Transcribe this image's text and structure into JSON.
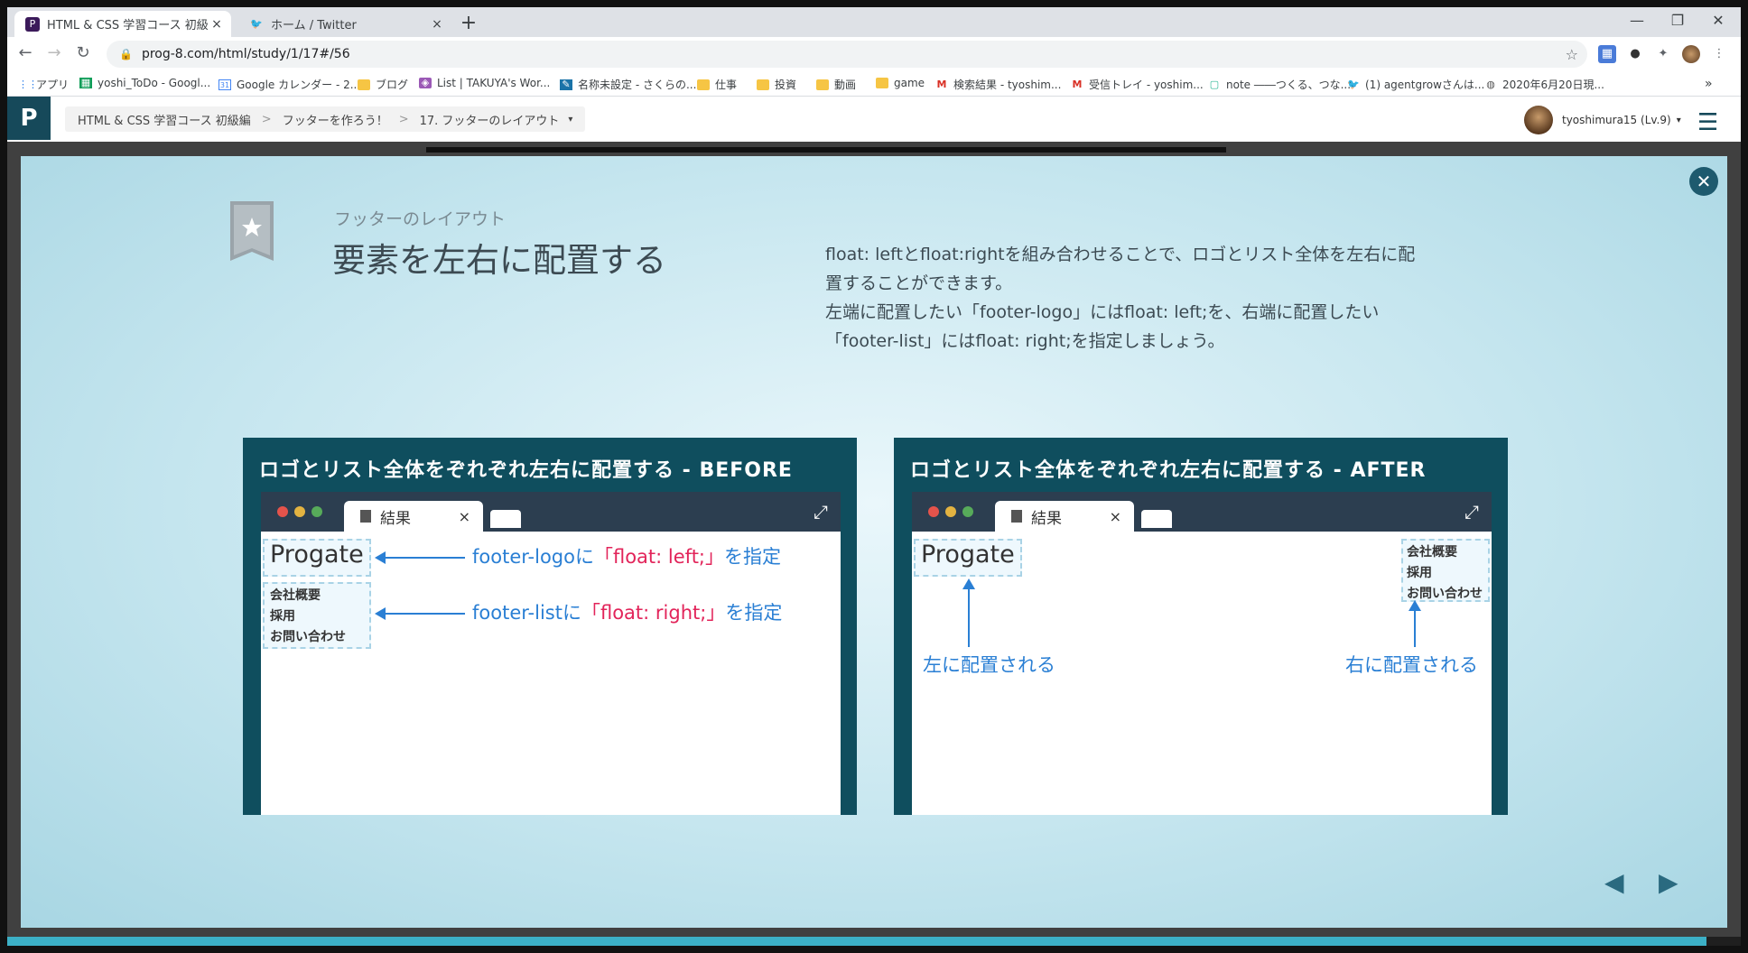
{
  "browser": {
    "tabs": [
      {
        "title": "HTML & CSS 学習コース 初級編 | ",
        "close": "×",
        "icon": "progate-icon",
        "icon_glyph": "P"
      },
      {
        "title": "ホーム / Twitter",
        "close": "×",
        "icon": "twitter-icon",
        "icon_glyph": "🐦"
      }
    ],
    "new_tab": "+",
    "window_controls": {
      "minimize": "—",
      "restore": "❐",
      "close": "✕"
    },
    "nav": {
      "back": "←",
      "forward": "→",
      "reload": "↻"
    },
    "url": "prog-8.com/html/study/1/17#/56",
    "lock": "🔒",
    "star": "☆",
    "bookmarks": [
      {
        "label": "アプリ",
        "icon": "apps-icon",
        "glyph": "⋮⋮"
      },
      {
        "label": "yoshi_ToDo - Googl...",
        "icon": "sheets-icon",
        "glyph": "▦"
      },
      {
        "label": "Google カレンダー - 2...",
        "icon": "calendar-icon",
        "glyph": "31"
      },
      {
        "label": "ブログ",
        "icon": "folder-icon",
        "glyph": ""
      },
      {
        "label": "List | TAKUYA's Wor...",
        "icon": "list-icon",
        "glyph": "◈"
      },
      {
        "label": "名称未設定 - さくらの...",
        "icon": "sakura-icon",
        "glyph": "✎"
      },
      {
        "label": "仕事",
        "icon": "folder-icon",
        "glyph": ""
      },
      {
        "label": "投資",
        "icon": "folder-icon",
        "glyph": ""
      },
      {
        "label": "動画",
        "icon": "folder-icon",
        "glyph": ""
      },
      {
        "label": "game",
        "icon": "folder-icon",
        "glyph": ""
      },
      {
        "label": "検索結果 - tyoshim...",
        "icon": "gmail-icon",
        "glyph": "M"
      },
      {
        "label": "受信トレイ - yoshim...",
        "icon": "gmail-icon",
        "glyph": "M"
      },
      {
        "label": "note ――つくる、つな...",
        "icon": "note-icon",
        "glyph": "▢"
      },
      {
        "label": "(1) agentgrowさんは...",
        "icon": "twitter-icon",
        "glyph": "🐦"
      },
      {
        "label": "2020年6月20日現...",
        "icon": "globe-icon",
        "glyph": "◍"
      }
    ],
    "bookmarks_more": "»"
  },
  "app": {
    "logo": "P",
    "breadcrumb": [
      "HTML & CSS 学習コース 初級編",
      "フッターを作ろう！",
      "17. フッターのレイアウト"
    ],
    "breadcrumb_sep": ">",
    "breadcrumb_caret": "▾",
    "user": "tyoshimura15 (Lv.9)",
    "user_caret": "▾",
    "menu": "☰"
  },
  "slide": {
    "close": "✕",
    "subtitle": "フッターのレイアウト",
    "title": "要素を左右に配置する",
    "description": [
      "float: leftとfloat:rightを組み合わせることで、ロゴとリスト全体を左右に配",
      "置することができます。",
      "左端に配置したい「footer-logo」にはfloat: left;を、右端に配置したい",
      "「footer-list」にはfloat: right;を指定しましょう。"
    ],
    "before": {
      "title": "ロゴとリスト全体をぞれぞれ左右に配置する - BEFORE",
      "tab": "結果",
      "tab_close": "×",
      "expand": "⤢",
      "logo": "Progate",
      "list": [
        "会社概要",
        "採用",
        "お問い合わせ"
      ],
      "note1_a": "footer-logoに",
      "note1_b": "「float: left;」",
      "note1_c": "を指定",
      "note2_a": "footer-listに",
      "note2_b": "「float: right;」",
      "note2_c": "を指定"
    },
    "after": {
      "title": "ロゴとリスト全体をぞれぞれ左右に配置する - AFTER",
      "tab": "結果",
      "tab_close": "×",
      "expand": "⤢",
      "logo": "Progate",
      "list": [
        "会社概要",
        "採用",
        "お問い合わせ"
      ],
      "left_note": "左に配置される",
      "right_note": "右に配置される"
    },
    "prev": "◀",
    "next": "▶"
  },
  "colors": {
    "panel": "#0f4e5e",
    "accent_blue": "#2a7fd4",
    "accent_red": "#e2245a",
    "progress": "#3cb0c6"
  },
  "progress": 0.98
}
